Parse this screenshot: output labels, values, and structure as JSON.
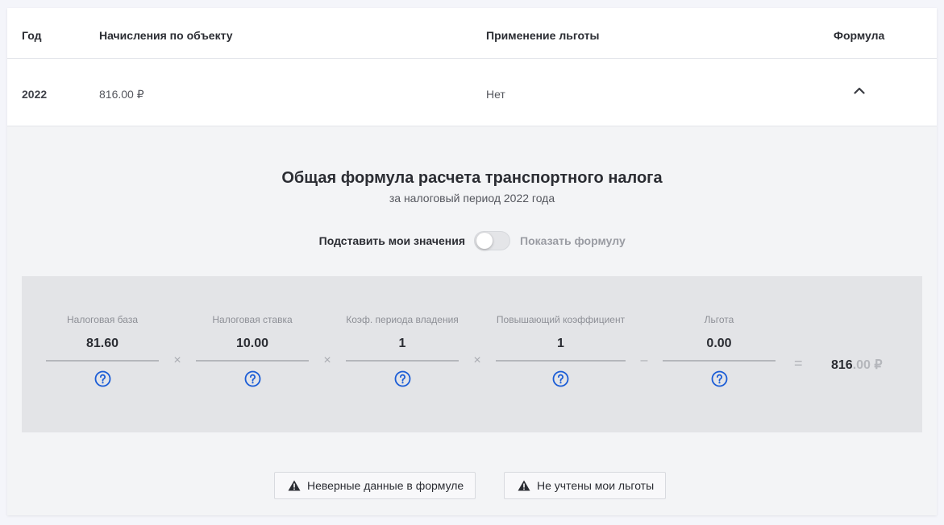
{
  "table": {
    "headers": {
      "year": "Год",
      "charges": "Начисления по объекту",
      "benefit": "Применение льготы",
      "formula": "Формула"
    },
    "rows": [
      {
        "year": "2022",
        "charges": "816.00 ₽",
        "benefit": "Нет",
        "formula_icon": "chevron-up-icon"
      }
    ]
  },
  "formula": {
    "title": "Общая формула расчета транспортного налога",
    "subtitle": "за налоговый период 2022 года",
    "toggle": {
      "left_label": "Подставить мои значения",
      "right_label": "Показать формулу",
      "state": "off"
    },
    "fields": [
      {
        "label": "Налоговая база",
        "value": "81.60"
      },
      {
        "label": "Налоговая ставка",
        "value": "10.00"
      },
      {
        "label": "Коэф. периода владения",
        "value": "1"
      },
      {
        "label": "Повышающий коэффициент",
        "value": "1"
      },
      {
        "label": "Льгота",
        "value": "0.00"
      }
    ],
    "operators": [
      "×",
      "×",
      "×",
      "–"
    ],
    "equals": "=",
    "result": {
      "int": "816",
      "frac": ".00 ₽"
    },
    "help_icon": "question-circle-icon"
  },
  "actions": {
    "wrong_data": "Неверные данные в формуле",
    "missing_benefits": "Не учтены мои льготы",
    "icon": "warning-triangle-icon"
  },
  "colors": {
    "accent": "#1a5cd6",
    "panel": "#e3e4e7",
    "details_bg": "#f3f4f6"
  }
}
